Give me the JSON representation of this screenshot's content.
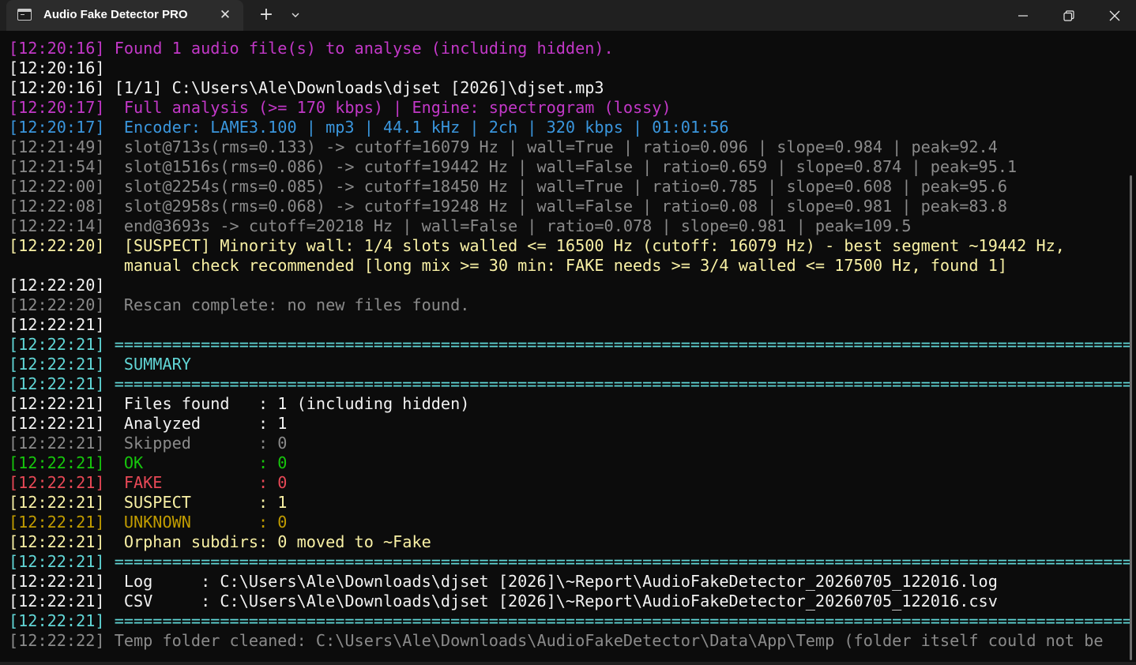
{
  "window": {
    "tab_title": "Audio Fake Detector PRO",
    "tab_icon": "terminal-icon",
    "close_tab_icon": "close-icon",
    "new_tab_label": "+",
    "new_tab_icon": "plus-icon",
    "dropdown_icon": "chevron-down-icon",
    "controls": [
      "minimize-icon",
      "restore-icon",
      "close-icon"
    ]
  },
  "colors": {
    "background": "#0c0c0c",
    "titlebar": "#202020",
    "tab": "#2c2c2c",
    "magenta": "#c238c7",
    "white": "#f2f2f2",
    "blue": "#3a96dd",
    "gray": "#8a8a8a",
    "yellow": "#f9f1a5",
    "cyan": "#61d6d6",
    "green": "#16c60c",
    "red": "#e74856",
    "gold": "#c19c00"
  },
  "console": {
    "lines": [
      "[12:20:16] Found 1 audio file(s) to analyse (including hidden).",
      "[12:20:16]",
      "[12:20:16] [1/1] C:\\Users\\Ale\\Downloads\\djset [2026]\\djset.mp3",
      "[12:20:17]  Full analysis (>= 170 kbps) | Engine: spectrogram (lossy)",
      "[12:20:17]  Encoder: LAME3.100 | mp3 | 44.1 kHz | 2ch | 320 kbps | 01:01:56",
      "[12:21:49]  slot@713s(rms=0.133) -> cutoff=16079 Hz | wall=True | ratio=0.096 | slope=0.984 | peak=92.4",
      "[12:21:54]  slot@1516s(rms=0.086) -> cutoff=19442 Hz | wall=False | ratio=0.659 | slope=0.874 | peak=95.1",
      "[12:22:00]  slot@2254s(rms=0.085) -> cutoff=18450 Hz | wall=True | ratio=0.785 | slope=0.608 | peak=95.6",
      "[12:22:08]  slot@2958s(rms=0.068) -> cutoff=19248 Hz | wall=False | ratio=0.08 | slope=0.981 | peak=83.8",
      "[12:22:14]  end@3693s -> cutoff=20218 Hz | wall=False | ratio=0.078 | slope=0.981 | peak=109.5",
      "[12:22:20]  [SUSPECT] Minority wall: 1/4 slots walled <= 16500 Hz (cutoff: 16079 Hz) - best segment ~19442 Hz,",
      "            manual check recommended [long mix >= 30 min: FAKE needs >= 3/4 walled <= 17500 Hz, found 1]",
      "[12:22:20]",
      "[12:22:20]  Rescan complete: no new files found.",
      "[12:22:21]",
      "[12:22:21] ==========================================================================================================",
      "[12:22:21]  SUMMARY",
      "[12:22:21] ==========================================================================================================",
      "[12:22:21]  Files found   : 1 (including hidden)",
      "[12:22:21]  Analyzed      : 1",
      "[12:22:21]  Skipped       : 0",
      "[12:22:21]  OK            : 0",
      "[12:22:21]  FAKE          : 0",
      "[12:22:21]  SUSPECT       : 1",
      "[12:22:21]  UNKNOWN       : 0",
      "[12:22:21]  Orphan subdirs: 0 moved to ~Fake",
      "[12:22:21] ==========================================================================================================",
      "[12:22:21]  Log     : C:\\Users\\Ale\\Downloads\\djset [2026]\\~Report\\AudioFakeDetector_20260705_122016.log",
      "[12:22:21]  CSV     : C:\\Users\\Ale\\Downloads\\djset [2026]\\~Report\\AudioFakeDetector_20260705_122016.csv",
      "[12:22:21] ==========================================================================================================",
      "[12:22:22] Temp folder cleaned: C:\\Users\\Ale\\Downloads\\AudioFakeDetector\\Data\\App\\Temp (folder itself could not be"
    ]
  }
}
